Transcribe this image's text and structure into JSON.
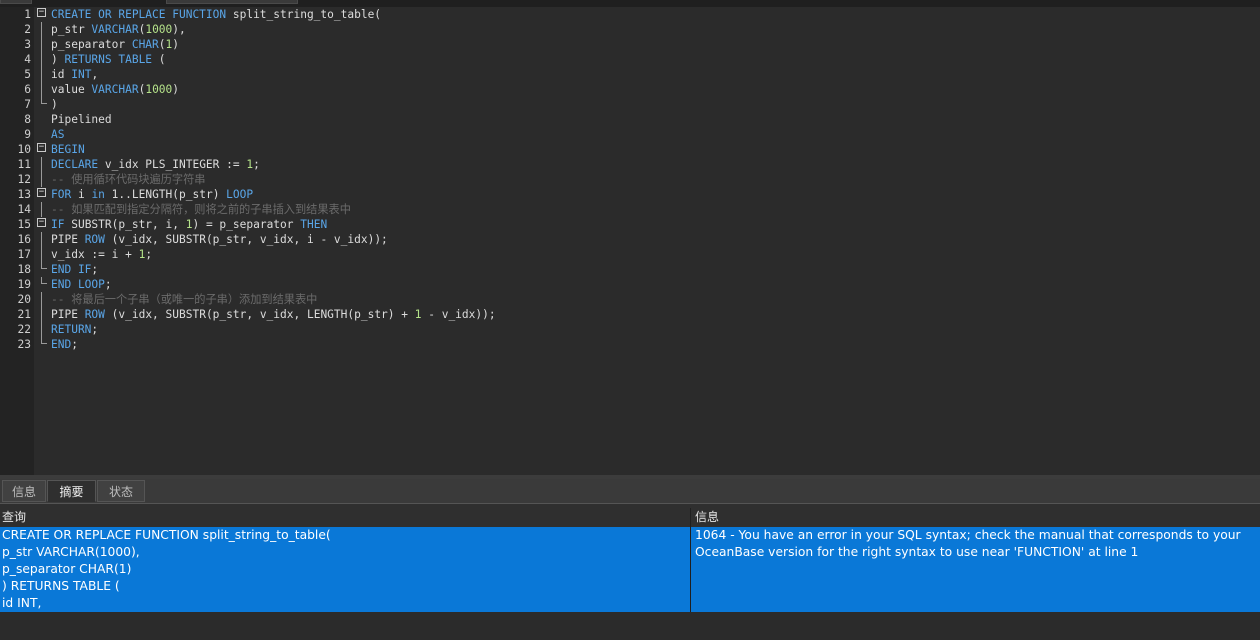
{
  "editor": {
    "lines": [
      {
        "n": "1",
        "segs": [
          [
            "kw",
            "CREATE OR REPLACE FUNCTION"
          ],
          [
            "t",
            " split_string_to_table("
          ]
        ]
      },
      {
        "n": "2",
        "segs": [
          [
            "t",
            "p_str "
          ],
          [
            "kw",
            "VARCHAR"
          ],
          [
            "t",
            "("
          ],
          [
            "num",
            "1000"
          ],
          [
            "t",
            "),"
          ]
        ]
      },
      {
        "n": "3",
        "segs": [
          [
            "t",
            "p_separator "
          ],
          [
            "kw",
            "CHAR"
          ],
          [
            "t",
            "("
          ],
          [
            "num",
            "1"
          ],
          [
            "t",
            ")"
          ]
        ]
      },
      {
        "n": "4",
        "segs": [
          [
            "t",
            ") "
          ],
          [
            "kw",
            "RETURNS TABLE"
          ],
          [
            "t",
            " ("
          ]
        ]
      },
      {
        "n": "5",
        "segs": [
          [
            "t",
            "id "
          ],
          [
            "kw",
            "INT"
          ],
          [
            "t",
            ","
          ]
        ]
      },
      {
        "n": "6",
        "segs": [
          [
            "t",
            "value "
          ],
          [
            "kw",
            "VARCHAR"
          ],
          [
            "t",
            "("
          ],
          [
            "num",
            "1000"
          ],
          [
            "t",
            ")"
          ]
        ]
      },
      {
        "n": "7",
        "segs": [
          [
            "t",
            ")"
          ]
        ]
      },
      {
        "n": "8",
        "segs": [
          [
            "t",
            "Pipelined"
          ]
        ]
      },
      {
        "n": "9",
        "segs": [
          [
            "kw",
            "AS"
          ]
        ]
      },
      {
        "n": "10",
        "segs": [
          [
            "kw",
            "BEGIN"
          ]
        ]
      },
      {
        "n": "11",
        "segs": [
          [
            "kw",
            "DECLARE"
          ],
          [
            "t",
            " v_idx PLS_INTEGER := "
          ],
          [
            "num",
            "1"
          ],
          [
            "t",
            ";"
          ]
        ]
      },
      {
        "n": "12",
        "segs": [
          [
            "cm",
            "-- 使用循环代码块遍历字符串"
          ]
        ]
      },
      {
        "n": "13",
        "segs": [
          [
            "kw",
            "FOR"
          ],
          [
            "t",
            " i "
          ],
          [
            "kw",
            "in"
          ],
          [
            "t",
            " 1..LENGTH(p_str) "
          ],
          [
            "kw",
            "LOOP"
          ]
        ]
      },
      {
        "n": "14",
        "segs": [
          [
            "cm",
            "-- 如果匹配到指定分隔符，则将之前的子串插入到结果表中"
          ]
        ]
      },
      {
        "n": "15",
        "segs": [
          [
            "kw",
            "IF"
          ],
          [
            "t",
            " SUBSTR(p_str, i, "
          ],
          [
            "num",
            "1"
          ],
          [
            "t",
            ") = p_separator "
          ],
          [
            "kw",
            "THEN"
          ]
        ]
      },
      {
        "n": "16",
        "segs": [
          [
            "t",
            "PIPE "
          ],
          [
            "kw",
            "ROW"
          ],
          [
            "t",
            " (v_idx, SUBSTR(p_str, v_idx, i - v_idx));"
          ]
        ]
      },
      {
        "n": "17",
        "segs": [
          [
            "t",
            "v_idx := i + "
          ],
          [
            "num",
            "1"
          ],
          [
            "t",
            ";"
          ]
        ]
      },
      {
        "n": "18",
        "segs": [
          [
            "kw",
            "END IF"
          ],
          [
            "t",
            ";"
          ]
        ]
      },
      {
        "n": "19",
        "segs": [
          [
            "kw",
            "END LOOP"
          ],
          [
            "t",
            ";"
          ]
        ]
      },
      {
        "n": "20",
        "segs": [
          [
            "cm",
            "-- 将最后一个子串（或唯一的子串）添加到结果表中"
          ]
        ]
      },
      {
        "n": "21",
        "segs": [
          [
            "t",
            "PIPE "
          ],
          [
            "kw",
            "ROW"
          ],
          [
            "t",
            " (v_idx, SUBSTR(p_str, v_idx, LENGTH(p_str) + "
          ],
          [
            "num",
            "1"
          ],
          [
            "t",
            " - v_idx));"
          ]
        ]
      },
      {
        "n": "22",
        "segs": [
          [
            "kw",
            "RETURN"
          ],
          [
            "t",
            ";"
          ]
        ]
      },
      {
        "n": "23",
        "segs": [
          [
            "kw",
            "END"
          ],
          [
            "t",
            ";"
          ]
        ]
      }
    ]
  },
  "tabs": [
    {
      "label": "信息",
      "active": false
    },
    {
      "label": "摘要",
      "active": true
    },
    {
      "label": "状态",
      "active": false
    }
  ],
  "result": {
    "col_query": "查询",
    "col_info": "信息",
    "query_lines": [
      "CREATE OR REPLACE FUNCTION split_string_to_table(",
      "p_str VARCHAR(1000),",
      "p_separator CHAR(1)",
      ") RETURNS TABLE (",
      "id INT,"
    ],
    "info_lines": [
      "1064 - You have an error in your SQL syntax; check the manual that corresponds to your",
      "OceanBase version for the right syntax to use near 'FUNCTION' at line 1"
    ]
  },
  "colors": {
    "keyword": "#5aa6e8",
    "number": "#b5e38a",
    "comment": "#6b6b6b",
    "selection": "#0a78d7"
  }
}
